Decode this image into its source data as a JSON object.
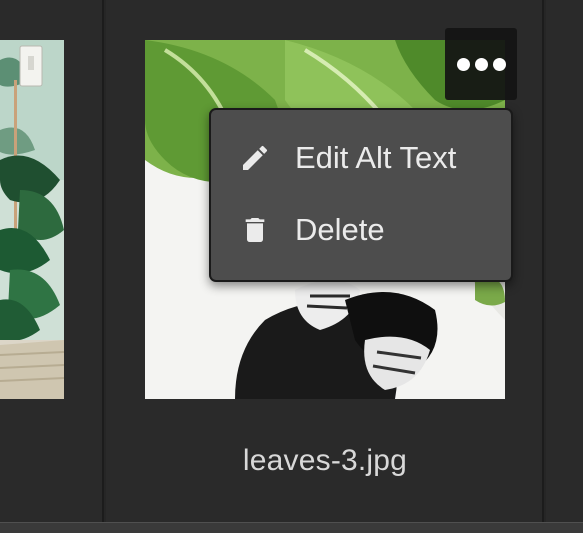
{
  "gallery": {
    "items": [
      {
        "filename": ""
      },
      {
        "filename": "leaves-3.jpg"
      }
    ]
  },
  "item_menu": {
    "trigger_icon": "ellipsis-icon",
    "items": [
      {
        "label": "Edit Alt Text",
        "icon": "pencil-icon"
      },
      {
        "label": "Delete",
        "icon": "trash-icon"
      }
    ]
  },
  "colors": {
    "background": "#262626",
    "menu_background": "#4d4d4d",
    "menu_text": "#ebebeb",
    "filename_text": "#d8d8d8"
  }
}
